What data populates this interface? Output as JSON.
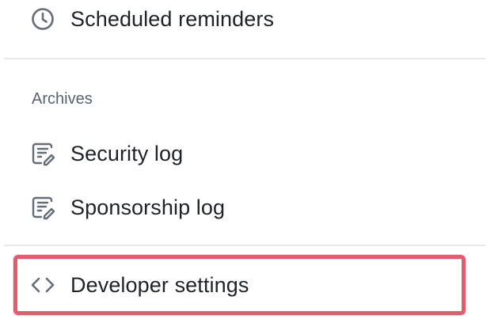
{
  "menu": {
    "scheduled_reminders": {
      "label": "Scheduled reminders",
      "icon": "clock-icon"
    },
    "archives_heading": "Archives",
    "security_log": {
      "label": "Security log",
      "icon": "log-icon"
    },
    "sponsorship_log": {
      "label": "Sponsorship log",
      "icon": "log-icon"
    },
    "developer_settings": {
      "label": "Developer settings",
      "icon": "code-icon",
      "highlighted": true
    }
  },
  "colors": {
    "highlight_border": "#e05d70",
    "icon": "#656d76",
    "text": "#1f2328",
    "muted_text": "#59636e",
    "divider": "#e5e7ea"
  }
}
